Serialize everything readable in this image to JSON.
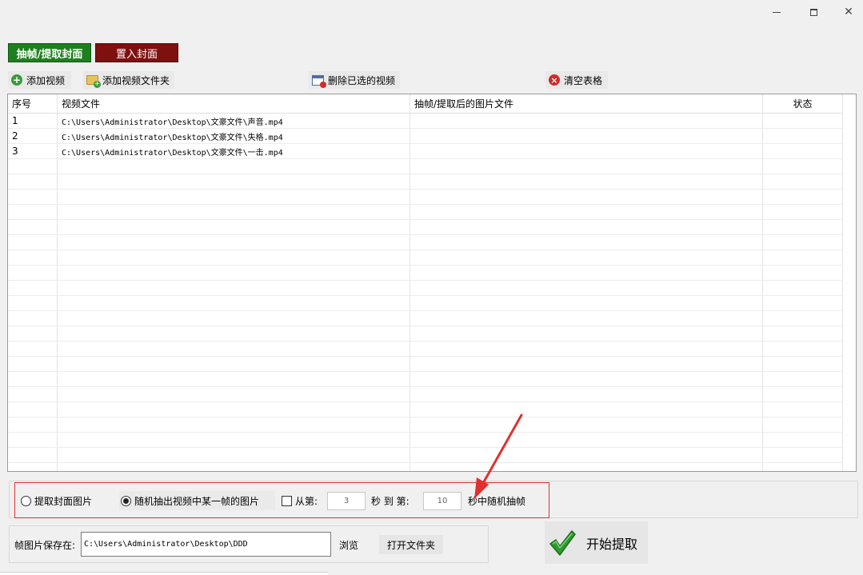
{
  "window": {
    "controls": {
      "minimize": "—",
      "maximize": "□",
      "close": "✕"
    }
  },
  "modes": {
    "extract": "抽帧/提取封面",
    "insert": "置入封面"
  },
  "toolbar": {
    "add_video": "添加视频",
    "add_video_folder": "添加视频文件夹",
    "delete_selected": "删除已选的视频",
    "clear_table": "清空表格"
  },
  "table": {
    "headers": {
      "index": "序号",
      "video_file": "视频文件",
      "output_file": "抽帧/提取后的图片文件",
      "status": "状态"
    },
    "rows": [
      {
        "index": "1",
        "video_file": "C:\\Users\\Administrator\\Desktop\\文豪文件\\声音.mp4",
        "output_file": "",
        "status": ""
      },
      {
        "index": "2",
        "video_file": "C:\\Users\\Administrator\\Desktop\\文豪文件\\失格.mp4",
        "output_file": "",
        "status": ""
      },
      {
        "index": "3",
        "video_file": "C:\\Users\\Administrator\\Desktop\\文豪文件\\一击.mp4",
        "output_file": "",
        "status": ""
      }
    ]
  },
  "options": {
    "extract_cover": {
      "label": "提取封面图片",
      "selected": false
    },
    "random_frame": {
      "label": "随机抽出视频中某一帧的图片",
      "selected": true
    },
    "range": {
      "from_label": "从第:",
      "checked": false,
      "start_value": "3",
      "to_label": "秒 到 第:",
      "end_value": "10",
      "suffix": "秒中随机抽帧"
    }
  },
  "save": {
    "label": "帧图片保存在:",
    "path": "C:\\Users\\Administrator\\Desktop\\DDD",
    "browse": "浏览",
    "open_folder": "打开文件夹"
  },
  "start_button": {
    "label": "开始提取"
  },
  "colors": {
    "extract_tab": "#1e7f1e",
    "insert_tab": "#7f1010",
    "annotation": "#e03030",
    "check_green": "#2f9a2f"
  }
}
